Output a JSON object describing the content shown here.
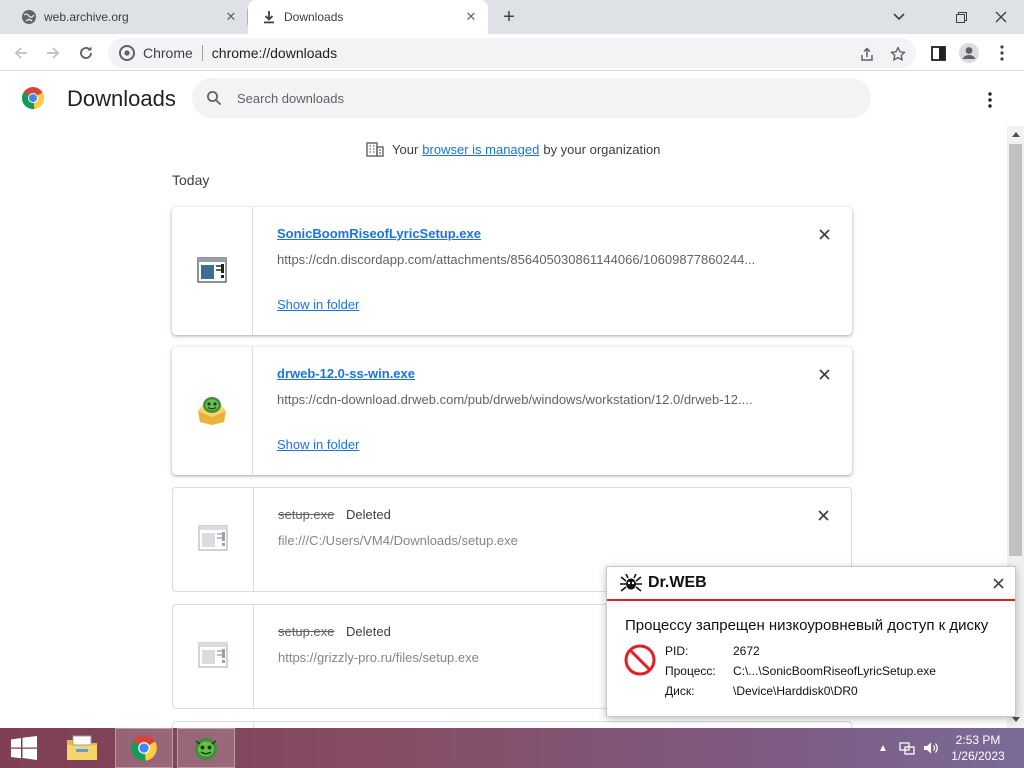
{
  "browser": {
    "tabs": [
      {
        "label": "web.archive.org",
        "icon": "globe-icon"
      },
      {
        "label": "Downloads",
        "icon": "download-icon"
      }
    ],
    "omnibox": {
      "site_label": "Chrome",
      "url": "chrome://downloads"
    }
  },
  "downloads": {
    "title": "Downloads",
    "search_placeholder": "Search downloads",
    "managed": {
      "before": "Your",
      "link": "browser is managed",
      "after": "by your organization"
    },
    "date_header": "Today",
    "items": [
      {
        "filename": "SonicBoomRiseofLyricSetup.exe",
        "status": "",
        "url": "https://cdn.discordapp.com/attachments/856405030861144066/10609877860244...",
        "action": "Show in folder",
        "deleted": false
      },
      {
        "filename": "drweb-12.0-ss-win.exe",
        "status": "",
        "url": "https://cdn-download.drweb.com/pub/drweb/windows/workstation/12.0/drweb-12....",
        "action": "Show in folder",
        "deleted": false
      },
      {
        "filename": "setup.exe",
        "status": "Deleted",
        "url": "file:///C:/Users/VM4/Downloads/setup.exe",
        "action": "",
        "deleted": true
      },
      {
        "filename": "setup.exe",
        "status": "Deleted",
        "url": "https://grizzly-pro.ru/files/setup.exe",
        "action": "",
        "deleted": true
      }
    ]
  },
  "drweb_popup": {
    "brand": "Dr.WEB",
    "message": "Процессу запрещен низкоуровневый доступ к диску",
    "rows": [
      {
        "key": "PID:",
        "value": "2672"
      },
      {
        "key": "Процесс:",
        "value": "C:\\...\\SonicBoomRiseofLyricSetup.exe"
      },
      {
        "key": "Диск:",
        "value": "\\Device\\Harddisk0\\DR0"
      }
    ],
    "accent": "#e41e26"
  },
  "taskbar": {
    "apps": [
      "file-explorer-icon",
      "chrome-icon",
      "drweb-icon"
    ],
    "clock": {
      "time": "2:53 PM",
      "date": "1/26/2023"
    }
  },
  "colors": {
    "link": "#1a73e8",
    "tabstrip": "#dee1e6",
    "omnibox": "#f1f3f4"
  }
}
